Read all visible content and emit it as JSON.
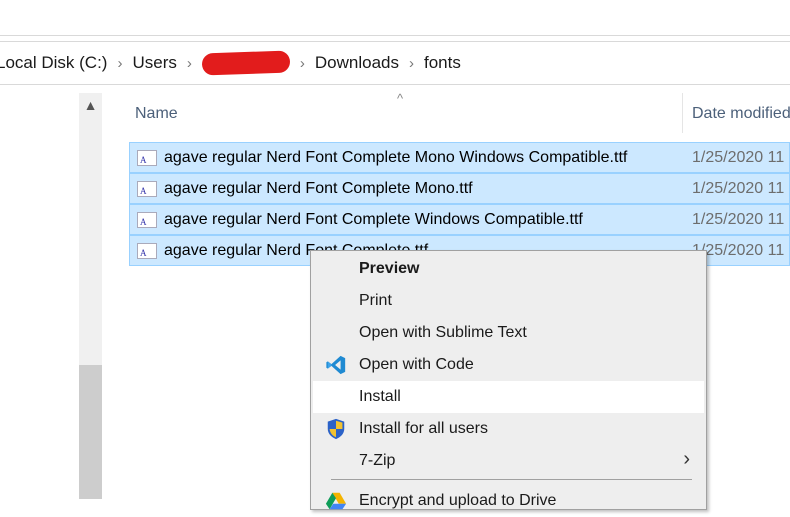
{
  "breadcrumb": [
    "Local Disk (C:)",
    "Users",
    "[redacted]",
    "Downloads",
    "fonts"
  ],
  "columns": {
    "name": "Name",
    "date": "Date modified"
  },
  "files": [
    {
      "name": "agave regular Nerd Font Complete Mono Windows Compatible.ttf",
      "date": "1/25/2020 11"
    },
    {
      "name": "agave regular Nerd Font Complete Mono.ttf",
      "date": "1/25/2020 11"
    },
    {
      "name": "agave regular Nerd Font Complete Windows Compatible.ttf",
      "date": "1/25/2020 11"
    },
    {
      "name": "agave regular Nerd Font Complete.ttf",
      "date": "1/25/2020 11"
    }
  ],
  "menu": [
    {
      "label": "Preview",
      "bold": true
    },
    {
      "label": "Print"
    },
    {
      "label": "Open with Sublime Text"
    },
    {
      "label": "Open with Code",
      "icon": "vscode-icon"
    },
    {
      "label": "Install",
      "highlighted": true
    },
    {
      "label": "Install for all users",
      "icon": "uac-shield-icon"
    },
    {
      "label": "7-Zip",
      "submenu": true
    },
    {
      "label": "Encrypt and upload to Drive",
      "icon": "google-drive-icon"
    }
  ],
  "colors": {
    "selection": "#cce8ff",
    "selection_border": "#99d1ff",
    "menu_bg": "#eeeeee",
    "redaction": "#e21c1c"
  }
}
